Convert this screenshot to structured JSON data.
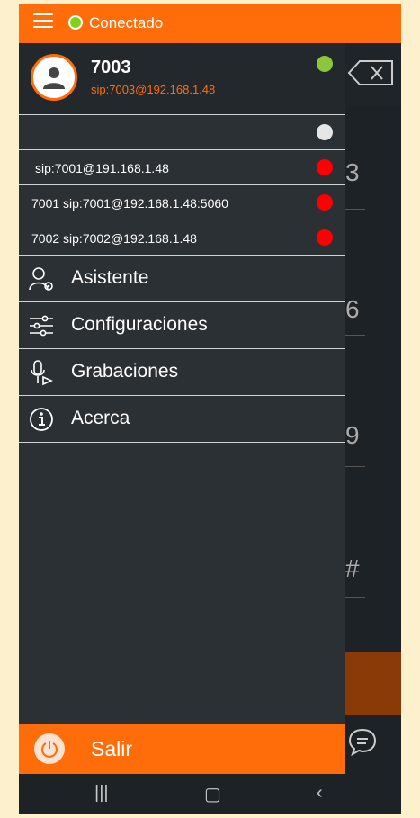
{
  "status": {
    "label": "Conectado",
    "color": "#7cd31a"
  },
  "profile": {
    "name": "7003",
    "sip": "sip:7003@192.168.1.48",
    "presence_color": "#8cc63f"
  },
  "accounts": [
    {
      "text": "",
      "dot": "#e6e6e6"
    },
    {
      "text": "sip:7001@191.168.1.48",
      "dot": "#ff0000"
    },
    {
      "text": "7001 sip:7001@192.168.1.48:5060",
      "dot": "#ff0000"
    },
    {
      "text": "7002 sip:7002@192.168.1.48",
      "dot": "#ff0000"
    }
  ],
  "menu": [
    {
      "label": "Asistente",
      "icon": "assistant-icon"
    },
    {
      "label": "Configuraciones",
      "icon": "settings-sliders-icon"
    },
    {
      "label": "Grabaciones",
      "icon": "recordings-icon"
    },
    {
      "label": "Acerca",
      "icon": "info-icon"
    }
  ],
  "logout": {
    "label": "Salir",
    "icon": "power-icon"
  },
  "colors": {
    "accent": "#ff6d0a",
    "drawer": "#2b3034"
  }
}
